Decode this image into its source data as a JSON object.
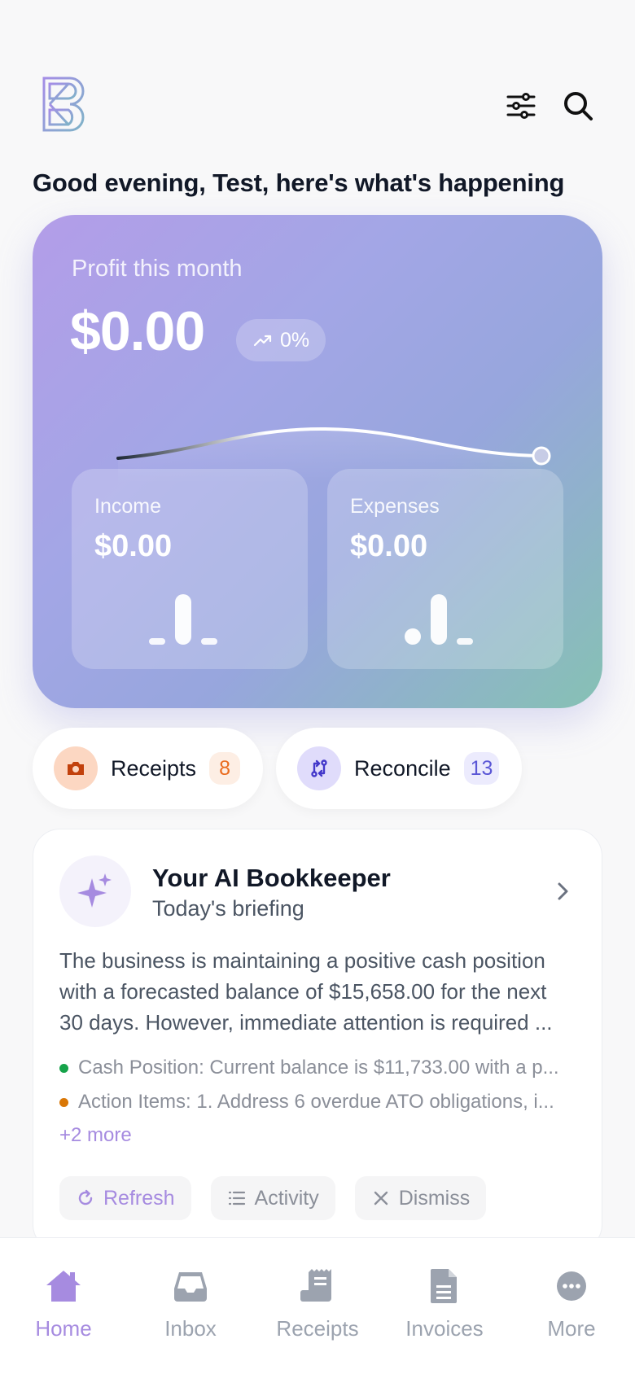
{
  "header": {
    "logo_icon": "bookkeeper-logo",
    "filter_icon": "sliders-icon",
    "search_icon": "search-icon"
  },
  "greeting": "Good evening, Test, here's what's happening",
  "profit": {
    "label": "Profit this month",
    "value": "$0.00",
    "change": "0%",
    "change_icon": "trend-up-icon"
  },
  "income": {
    "label": "Income",
    "value": "$0.00"
  },
  "expenses": {
    "label": "Expenses",
    "value": "$0.00"
  },
  "chips": {
    "receipts": {
      "label": "Receipts",
      "count": "8",
      "icon": "camera-icon"
    },
    "reconcile": {
      "label": "Reconcile",
      "count": "13",
      "icon": "reconcile-icon"
    }
  },
  "ai": {
    "title": "Your AI Bookkeeper",
    "subtitle": "Today's briefing",
    "body_lines": [
      "The business is maintaining a positive cash position",
      "with a forecasted balance of $15,658.00 for the next",
      "30 days. However, immediate attention is required ..."
    ],
    "bullets": [
      {
        "text": "Cash Position: Current balance is $11,733.00 with a p...",
        "color": "#16a34a"
      },
      {
        "text": "Action Items: 1. Address 6 overdue ATO obligations, i...",
        "color": "#d97706"
      }
    ],
    "more": "+2 more",
    "actions": {
      "refresh": "Refresh",
      "activity": "Activity",
      "dismiss": "Dismiss"
    }
  },
  "nav": [
    {
      "label": "Home",
      "icon": "home-icon",
      "active": true
    },
    {
      "label": "Inbox",
      "icon": "inbox-icon",
      "active": false
    },
    {
      "label": "Receipts",
      "icon": "receipt-icon",
      "active": false
    },
    {
      "label": "Invoices",
      "icon": "invoice-icon",
      "active": false
    },
    {
      "label": "More",
      "icon": "more-icon",
      "active": false
    }
  ],
  "colors": {
    "accent": "#a68be0",
    "receipts_accent": "#ea6c1f",
    "reconcile_accent": "#5b57d6"
  }
}
